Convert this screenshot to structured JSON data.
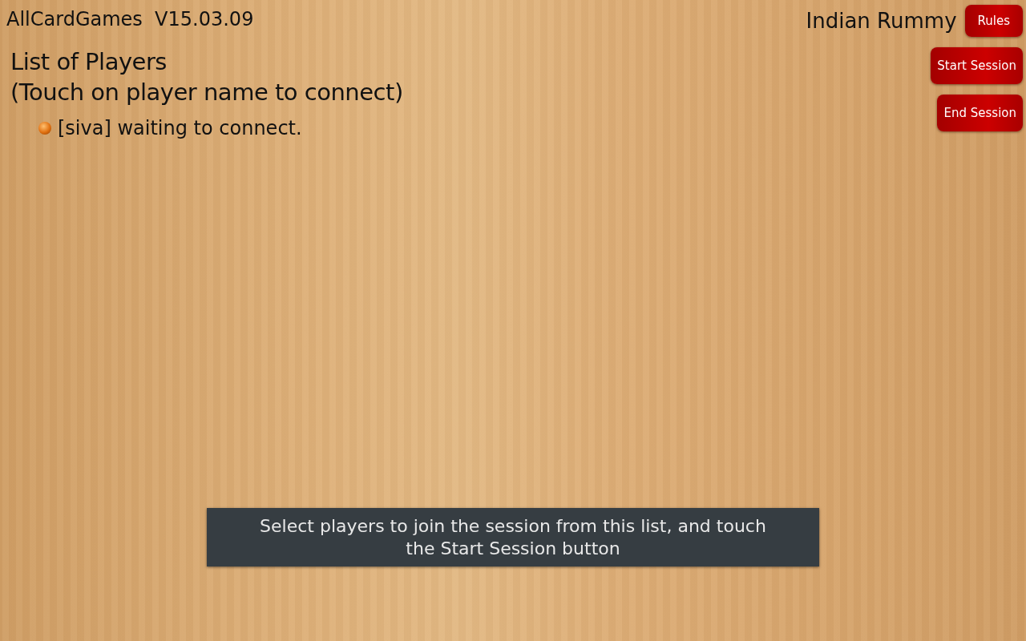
{
  "app_title": "AllCardGames  V15.03.09",
  "game_name": "Indian Rummy",
  "buttons": [
    {
      "label": "Rules"
    },
    {
      "label": "Start Session"
    },
    {
      "label": "End Session"
    }
  ],
  "players_heading": "List of Players",
  "players_hint": "(Touch on player name to connect)",
  "players": [
    {
      "text": "[siva] waiting to connect."
    }
  ],
  "toast": "Select players to join the session from this list, and touch\nthe Start Session button"
}
